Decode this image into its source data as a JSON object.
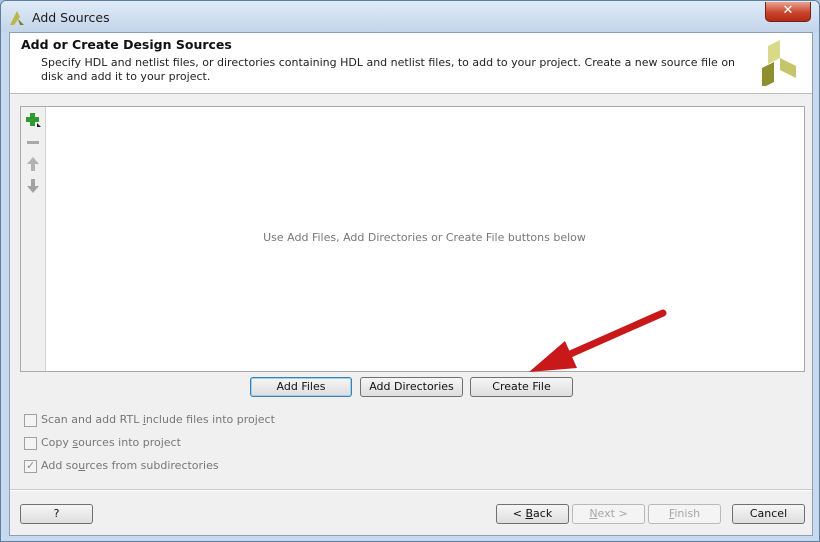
{
  "window": {
    "title": "Add Sources",
    "close_glyph": "✕"
  },
  "header": {
    "title": "Add or Create Design Sources",
    "description": "Specify HDL and netlist files, or directories containing HDL and netlist files, to add to your project. Create a new source file on disk and add it to your project."
  },
  "list": {
    "empty_message": "Use Add Files, Add Directories or Create File buttons below",
    "toolbar": [
      "add-icon",
      "remove-icon",
      "move-up-icon",
      "move-down-icon"
    ]
  },
  "actions": {
    "add_files": "Add Files",
    "add_directories": "Add Directories",
    "create_file": "Create File"
  },
  "options": {
    "scan_rtl": {
      "pre": "Scan and add RTL ",
      "key": "i",
      "post": "nclude files into project",
      "checked": false
    },
    "copy_sources": {
      "pre": "Copy ",
      "key": "s",
      "post": "ources into project",
      "checked": false
    },
    "add_subdirs": {
      "pre": "Add so",
      "key": "u",
      "post": "rces from subdirectories",
      "checked": true
    }
  },
  "footer": {
    "help": "?",
    "back": {
      "pre": "< ",
      "key": "B",
      "post": "ack"
    },
    "next": {
      "pre": "",
      "key": "N",
      "post": "ext >"
    },
    "finish": {
      "pre": "",
      "key": "F",
      "post": "inish"
    },
    "cancel": "Cancel"
  },
  "colors": {
    "arrow": "#c8181a",
    "logo_light": "#d9d98a",
    "logo_dark": "#8f8f2f",
    "accent": "#3c7fb1"
  }
}
